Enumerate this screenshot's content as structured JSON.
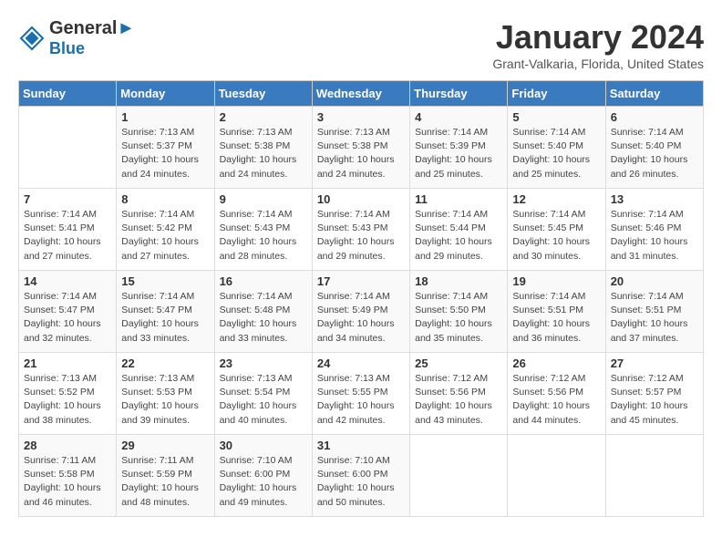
{
  "header": {
    "logo_line1": "General",
    "logo_line2": "Blue",
    "month_title": "January 2024",
    "location": "Grant-Valkaria, Florida, United States"
  },
  "weekdays": [
    "Sunday",
    "Monday",
    "Tuesday",
    "Wednesday",
    "Thursday",
    "Friday",
    "Saturday"
  ],
  "weeks": [
    [
      {
        "day": "",
        "info": ""
      },
      {
        "day": "1",
        "info": "Sunrise: 7:13 AM\nSunset: 5:37 PM\nDaylight: 10 hours\nand 24 minutes."
      },
      {
        "day": "2",
        "info": "Sunrise: 7:13 AM\nSunset: 5:38 PM\nDaylight: 10 hours\nand 24 minutes."
      },
      {
        "day": "3",
        "info": "Sunrise: 7:13 AM\nSunset: 5:38 PM\nDaylight: 10 hours\nand 24 minutes."
      },
      {
        "day": "4",
        "info": "Sunrise: 7:14 AM\nSunset: 5:39 PM\nDaylight: 10 hours\nand 25 minutes."
      },
      {
        "day": "5",
        "info": "Sunrise: 7:14 AM\nSunset: 5:40 PM\nDaylight: 10 hours\nand 25 minutes."
      },
      {
        "day": "6",
        "info": "Sunrise: 7:14 AM\nSunset: 5:40 PM\nDaylight: 10 hours\nand 26 minutes."
      }
    ],
    [
      {
        "day": "7",
        "info": "Sunrise: 7:14 AM\nSunset: 5:41 PM\nDaylight: 10 hours\nand 27 minutes."
      },
      {
        "day": "8",
        "info": "Sunrise: 7:14 AM\nSunset: 5:42 PM\nDaylight: 10 hours\nand 27 minutes."
      },
      {
        "day": "9",
        "info": "Sunrise: 7:14 AM\nSunset: 5:43 PM\nDaylight: 10 hours\nand 28 minutes."
      },
      {
        "day": "10",
        "info": "Sunrise: 7:14 AM\nSunset: 5:43 PM\nDaylight: 10 hours\nand 29 minutes."
      },
      {
        "day": "11",
        "info": "Sunrise: 7:14 AM\nSunset: 5:44 PM\nDaylight: 10 hours\nand 29 minutes."
      },
      {
        "day": "12",
        "info": "Sunrise: 7:14 AM\nSunset: 5:45 PM\nDaylight: 10 hours\nand 30 minutes."
      },
      {
        "day": "13",
        "info": "Sunrise: 7:14 AM\nSunset: 5:46 PM\nDaylight: 10 hours\nand 31 minutes."
      }
    ],
    [
      {
        "day": "14",
        "info": "Sunrise: 7:14 AM\nSunset: 5:47 PM\nDaylight: 10 hours\nand 32 minutes."
      },
      {
        "day": "15",
        "info": "Sunrise: 7:14 AM\nSunset: 5:47 PM\nDaylight: 10 hours\nand 33 minutes."
      },
      {
        "day": "16",
        "info": "Sunrise: 7:14 AM\nSunset: 5:48 PM\nDaylight: 10 hours\nand 33 minutes."
      },
      {
        "day": "17",
        "info": "Sunrise: 7:14 AM\nSunset: 5:49 PM\nDaylight: 10 hours\nand 34 minutes."
      },
      {
        "day": "18",
        "info": "Sunrise: 7:14 AM\nSunset: 5:50 PM\nDaylight: 10 hours\nand 35 minutes."
      },
      {
        "day": "19",
        "info": "Sunrise: 7:14 AM\nSunset: 5:51 PM\nDaylight: 10 hours\nand 36 minutes."
      },
      {
        "day": "20",
        "info": "Sunrise: 7:14 AM\nSunset: 5:51 PM\nDaylight: 10 hours\nand 37 minutes."
      }
    ],
    [
      {
        "day": "21",
        "info": "Sunrise: 7:13 AM\nSunset: 5:52 PM\nDaylight: 10 hours\nand 38 minutes."
      },
      {
        "day": "22",
        "info": "Sunrise: 7:13 AM\nSunset: 5:53 PM\nDaylight: 10 hours\nand 39 minutes."
      },
      {
        "day": "23",
        "info": "Sunrise: 7:13 AM\nSunset: 5:54 PM\nDaylight: 10 hours\nand 40 minutes."
      },
      {
        "day": "24",
        "info": "Sunrise: 7:13 AM\nSunset: 5:55 PM\nDaylight: 10 hours\nand 42 minutes."
      },
      {
        "day": "25",
        "info": "Sunrise: 7:12 AM\nSunset: 5:56 PM\nDaylight: 10 hours\nand 43 minutes."
      },
      {
        "day": "26",
        "info": "Sunrise: 7:12 AM\nSunset: 5:56 PM\nDaylight: 10 hours\nand 44 minutes."
      },
      {
        "day": "27",
        "info": "Sunrise: 7:12 AM\nSunset: 5:57 PM\nDaylight: 10 hours\nand 45 minutes."
      }
    ],
    [
      {
        "day": "28",
        "info": "Sunrise: 7:11 AM\nSunset: 5:58 PM\nDaylight: 10 hours\nand 46 minutes."
      },
      {
        "day": "29",
        "info": "Sunrise: 7:11 AM\nSunset: 5:59 PM\nDaylight: 10 hours\nand 48 minutes."
      },
      {
        "day": "30",
        "info": "Sunrise: 7:10 AM\nSunset: 6:00 PM\nDaylight: 10 hours\nand 49 minutes."
      },
      {
        "day": "31",
        "info": "Sunrise: 7:10 AM\nSunset: 6:00 PM\nDaylight: 10 hours\nand 50 minutes."
      },
      {
        "day": "",
        "info": ""
      },
      {
        "day": "",
        "info": ""
      },
      {
        "day": "",
        "info": ""
      }
    ]
  ]
}
